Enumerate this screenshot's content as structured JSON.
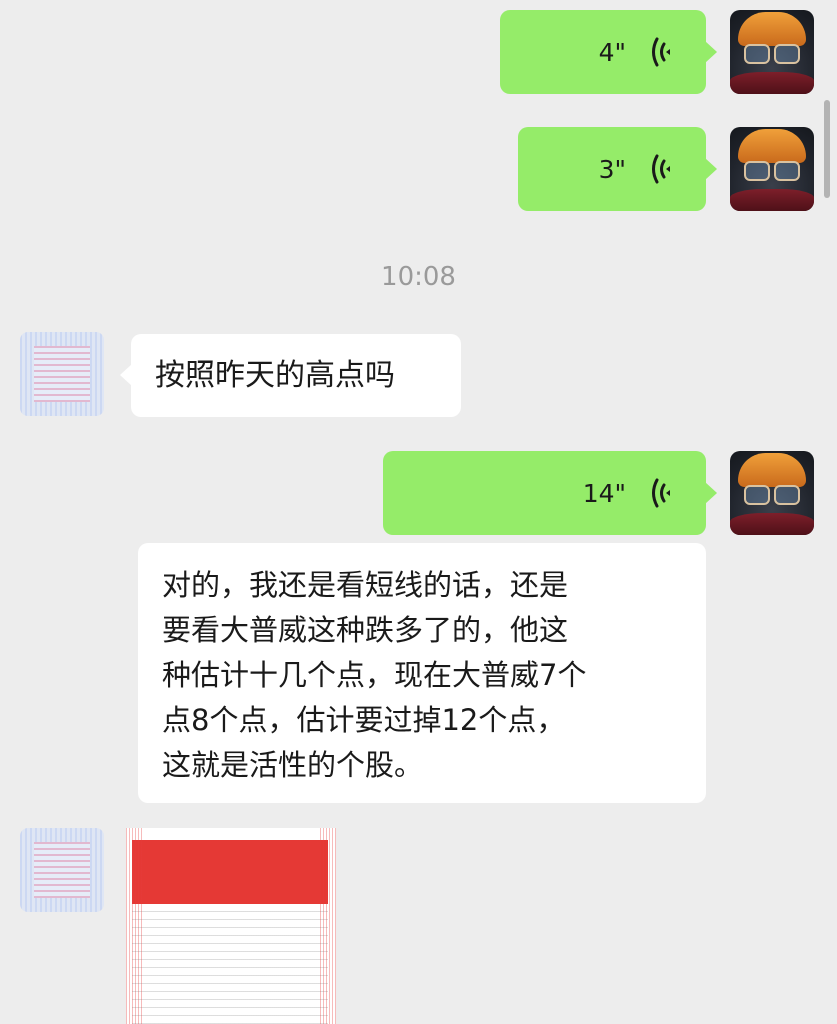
{
  "conversation": {
    "timestamp": "10:08",
    "messages": [
      {
        "side": "right",
        "type": "voice",
        "duration": "4\""
      },
      {
        "side": "right",
        "type": "voice",
        "duration": "3\""
      },
      {
        "side": "left",
        "type": "text",
        "text": "按照昨天的高点吗"
      },
      {
        "side": "right",
        "type": "voice",
        "duration": "14\""
      },
      {
        "side": "left",
        "type": "text",
        "lines": [
          "对的，我还是看短线的话，还是",
          "要看大普威这种跌多了的，他这",
          "种估计十几个点，现在大普威7个",
          "点8个点，估计要过掉12个点，",
          "这就是活性的个股。"
        ]
      },
      {
        "side": "left",
        "type": "image"
      }
    ]
  },
  "colors": {
    "background": "#ededed",
    "self_bubble": "#95ec69",
    "other_bubble": "#ffffff",
    "timestamp_text": "#9a9a9a"
  },
  "icons": {
    "voice": "voice-wave-icon",
    "self_avatar": "cat-avatar",
    "other_avatar": "pixel-avatar"
  }
}
